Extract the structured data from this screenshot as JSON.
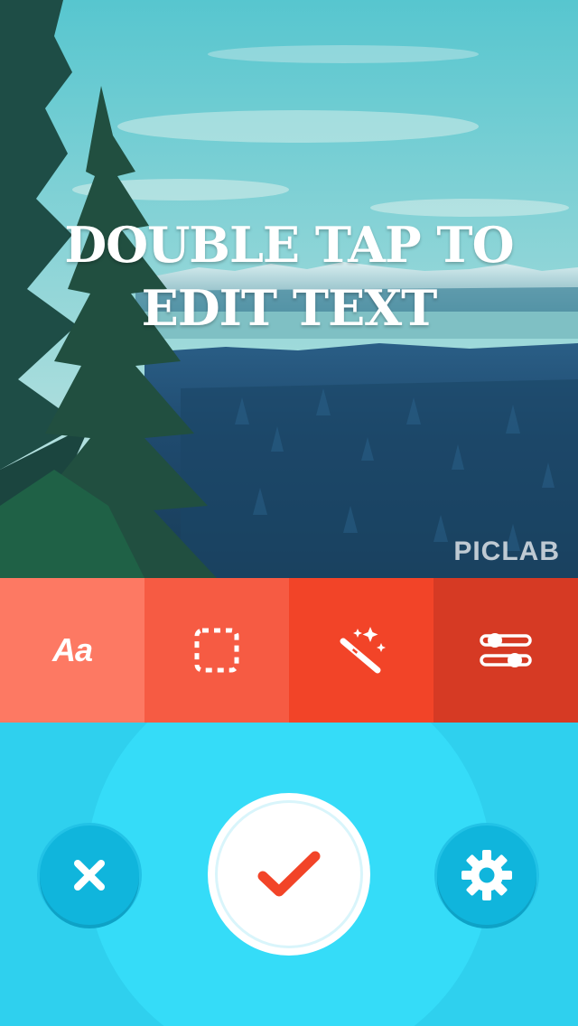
{
  "canvas": {
    "overlay_text": "DOUBLE TAP TO EDIT TEXT",
    "watermark": "PICLAB"
  },
  "toolbar": {
    "tools": [
      {
        "id": "text",
        "label": "Aa",
        "icon": "text-icon",
        "color": "#fd7963"
      },
      {
        "id": "crop",
        "icon": "crop-icon",
        "color": "#f65b43"
      },
      {
        "id": "effects",
        "icon": "magic-wand-icon",
        "color": "#f24428"
      },
      {
        "id": "adjust",
        "icon": "sliders-icon",
        "color": "#d63a24"
      }
    ]
  },
  "actions": {
    "cancel_icon": "close-icon",
    "confirm_icon": "checkmark-icon",
    "settings_icon": "gear-icon",
    "background_color": "#2fd0ee",
    "accent_color": "#f24428"
  }
}
